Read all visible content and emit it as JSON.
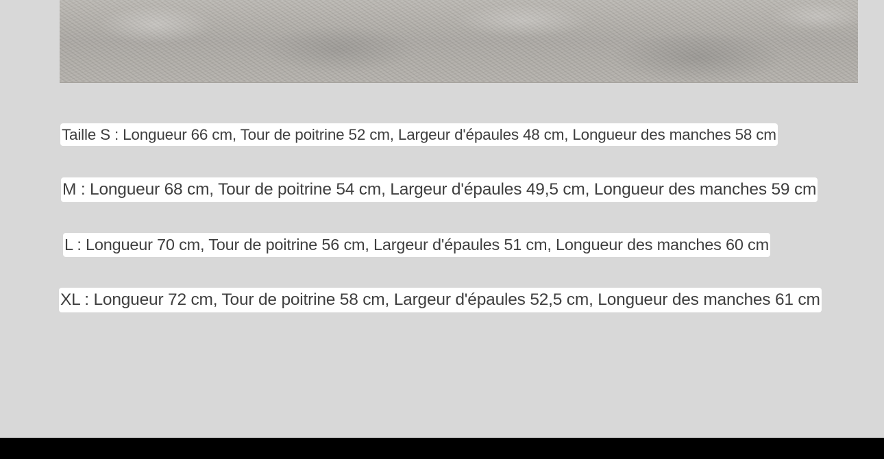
{
  "sizes": [
    "Taille S : Longueur 66 cm, Tour de poitrine 52 cm, Largeur d'épaules 48 cm, Longueur des manches 58 cm",
    "M : Longueur 68 cm, Tour de poitrine 54 cm, Largeur d'épaules 49,5 cm, Longueur des manches 59 cm",
    "L : Longueur 70 cm, Tour de poitrine 56 cm, Largeur d'épaules 51 cm, Longueur des manches 60 cm",
    "XL : Longueur 72 cm, Tour de poitrine 58 cm, Largeur d'épaules 52,5 cm, Longueur des manches 61 cm"
  ],
  "colors": {
    "background": "#d8d8d8",
    "text": "#3f3f3f",
    "label_background": "#ffffff",
    "bottom_bar": "#000000"
  }
}
